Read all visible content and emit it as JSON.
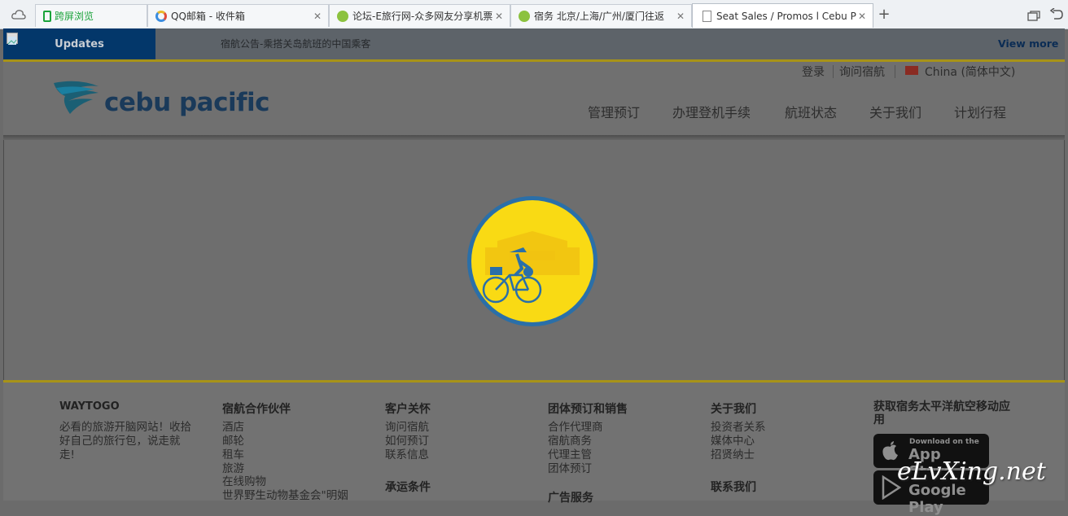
{
  "browser": {
    "tabs": [
      {
        "label": "跨屏浏览",
        "color": "#1aa33a",
        "closable": false
      },
      {
        "label": "QQ邮箱 - 收件箱",
        "color": "#e8b82a",
        "closable": true
      },
      {
        "label": "论坛-E旅行网-众多网友分享机票",
        "color": "#8cc23f",
        "closable": true
      },
      {
        "label": "宿务 北京/上海/广州/厦门往返",
        "color": "#8cc23f",
        "closable": true
      },
      {
        "label": "Seat Sales / Promos l Cebu Pacific",
        "color": "#888888",
        "closable": true
      }
    ],
    "new_tab": "+"
  },
  "updates": {
    "label": "Updates",
    "message": "宿航公告-乘搭关岛航班的中国乘客",
    "view_more": "View more"
  },
  "header": {
    "logo_text": "cebu pacific",
    "top_links": {
      "login": "登录",
      "ask": "询问宿航",
      "country": "China (简体中文)"
    },
    "nav": [
      "管理预订",
      "办理登机手续",
      "航班状态",
      "关于我们",
      "计划行程"
    ]
  },
  "footer": {
    "columns": [
      {
        "title": "WAYTOGO",
        "items": [
          "必看的旅游开脑网站！收拾",
          "好自己的旅行包，说走就",
          "走!"
        ]
      },
      {
        "title": "宿航合作伙伴",
        "items": [
          "酒店",
          "邮轮",
          "租车",
          "旅游",
          "在线购物",
          "世界野生动物基金会\"明姻"
        ]
      },
      {
        "title": "客户关怀",
        "items": [
          "询问宿航",
          "如何预订",
          "联系信息"
        ],
        "sub_title": "承运条件"
      },
      {
        "title": "团体预订和销售",
        "items": [
          "合作代理商",
          "宿航商务",
          "代理主管",
          "团体预订"
        ],
        "sub_title": "广告服务"
      },
      {
        "title": "关于我们",
        "items": [
          "投资者关系",
          "媒体中心",
          "招贤纳士"
        ],
        "sub_title": "联系我们"
      },
      {
        "title": "获取宿务太平洋航空移动应用",
        "items": []
      }
    ],
    "app_store": {
      "small": "Download on the",
      "big": "App Store"
    },
    "google_play": {
      "big": "Google Play"
    }
  },
  "watermark": "eLvXing.net"
}
